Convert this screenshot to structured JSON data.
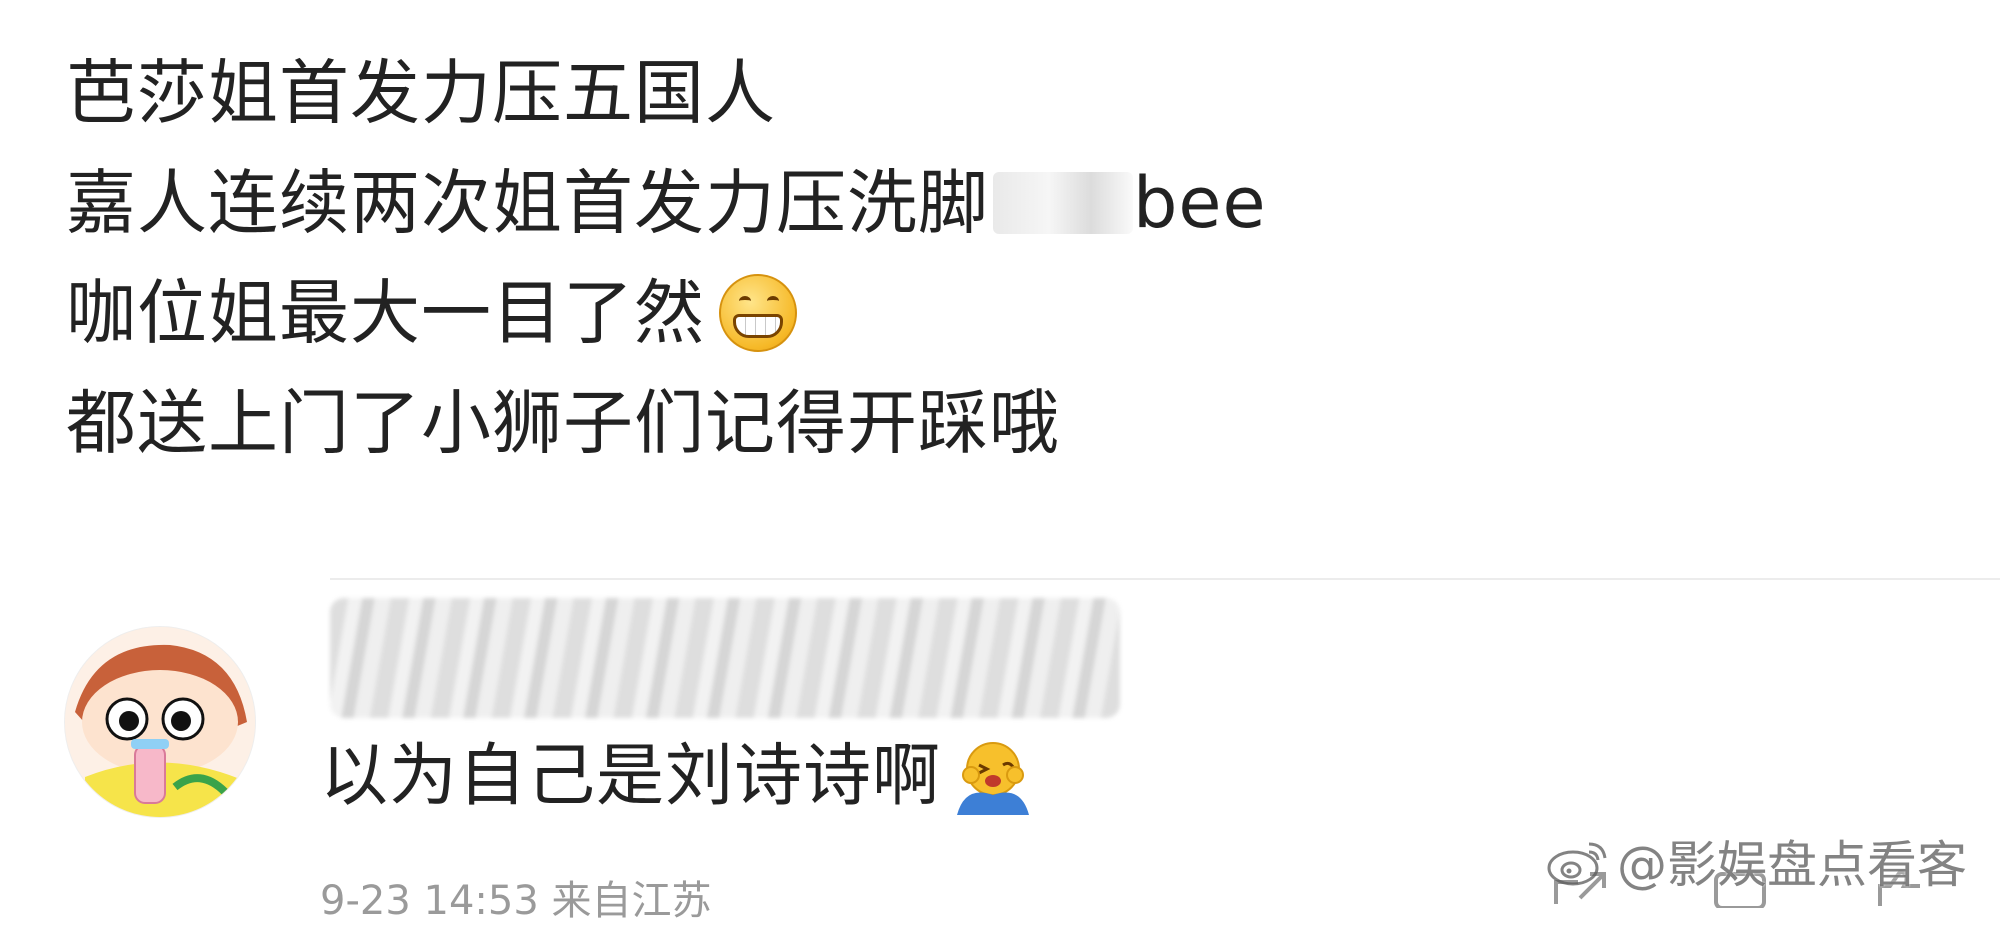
{
  "post": {
    "lines": [
      {
        "text": "芭莎姐首发力压五国人"
      },
      {
        "text_before": "嘉人连续两次姐首发力压洗脚",
        "text_after": "bee"
      },
      {
        "text": "咖位姐最大一目了然",
        "emoji": "grinning-face-icon"
      },
      {
        "text": "都送上门了小狮子们记得开踩哦"
      }
    ]
  },
  "comment": {
    "username": "",
    "text": "以为自己是刘诗诗啊",
    "emoji": "hand-over-face-icon",
    "meta": "9-23 14:53 来自江苏"
  },
  "watermark": {
    "text": "@影娱盘点看客",
    "icon": "weibo-icon"
  },
  "colors": {
    "text": "#222222",
    "meta": "#9a9a9a",
    "divider": "#ececec"
  }
}
